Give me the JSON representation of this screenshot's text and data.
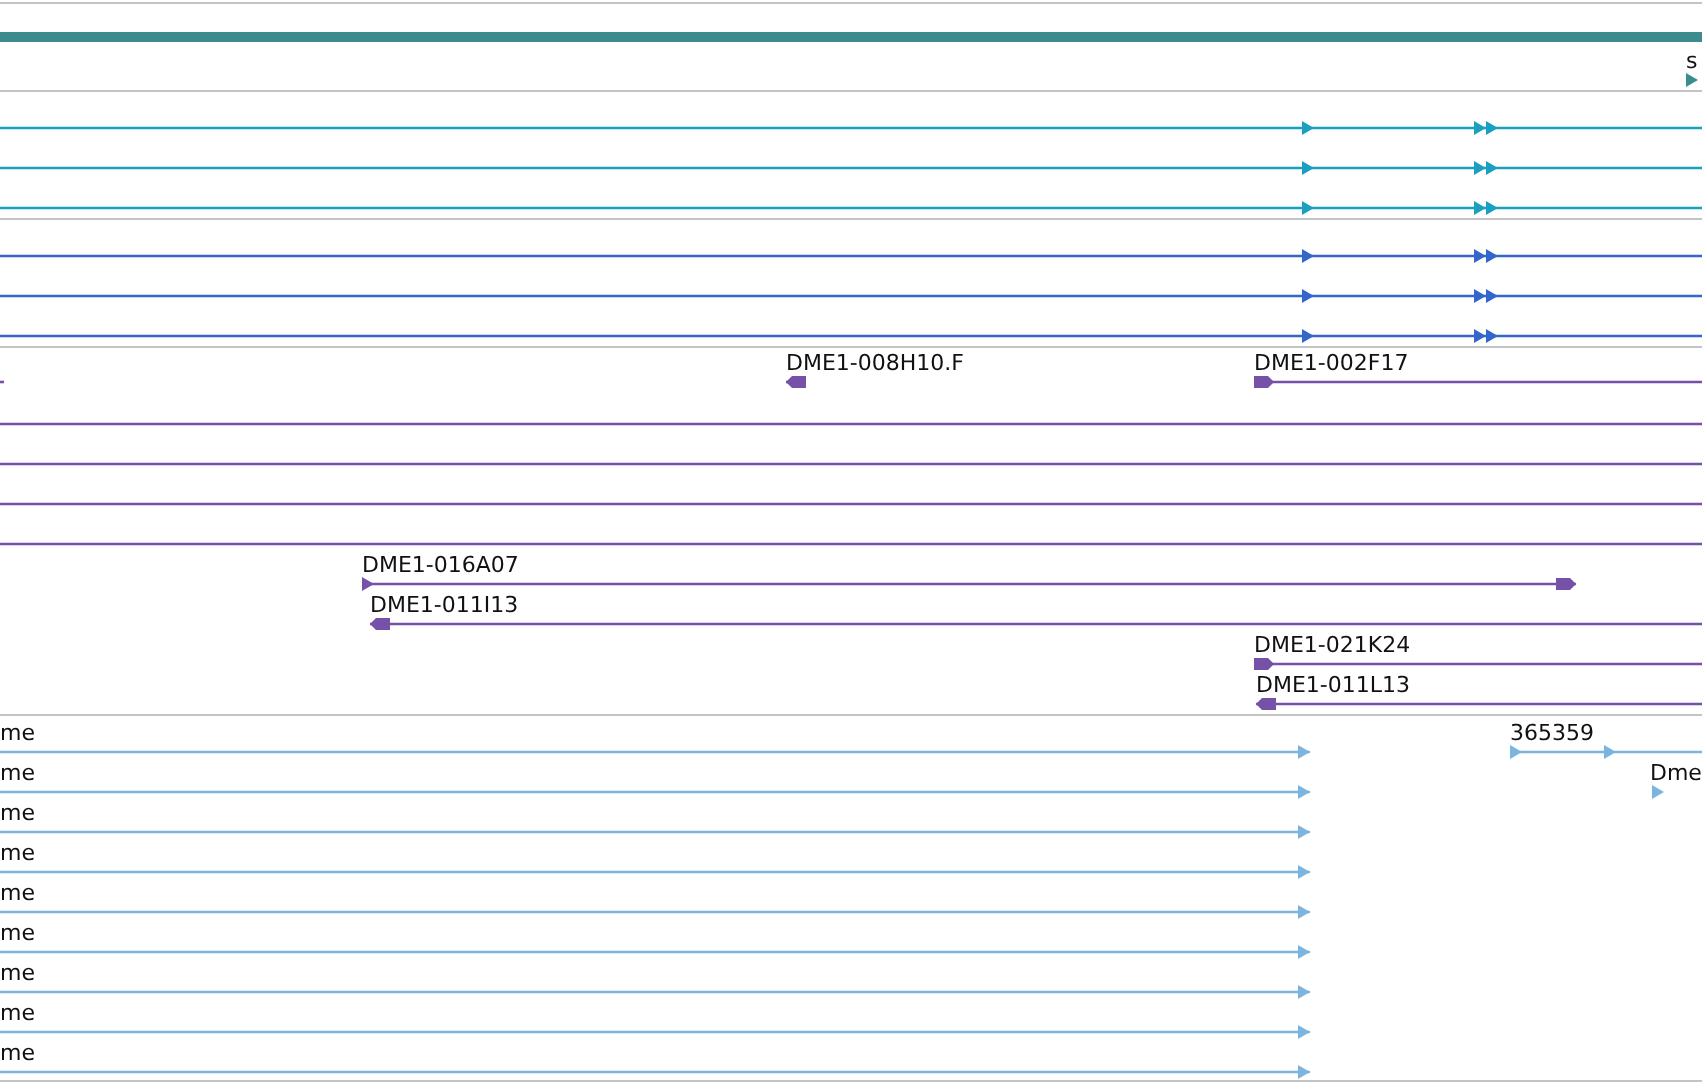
{
  "tracks": [
    {
      "color": "#3d8b8d",
      "features": [
        {
          "label": "s",
          "reverse": false
        }
      ]
    },
    {
      "color": "#1a9fc0",
      "features": [
        {
          "reverse": false
        },
        {
          "reverse": false
        },
        {
          "reverse": false
        }
      ]
    },
    {
      "color": "#3366cc",
      "features": [
        {
          "reverse": false
        },
        {
          "reverse": false
        },
        {
          "reverse": false
        }
      ]
    },
    {
      "color": "#7552a8",
      "features": [
        {
          "kind": "bare"
        },
        {
          "kind": "arrow",
          "label": "DME1-008H10.F",
          "reverse": true
        },
        {
          "kind": "arrow",
          "label": "DME1-002F17",
          "reverse": false
        },
        {
          "kind": "bare"
        },
        {
          "kind": "bare"
        },
        {
          "kind": "bare"
        },
        {
          "kind": "bare"
        },
        {
          "kind": "arrow",
          "label": "DME1-016A07",
          "reverse": false
        },
        {
          "kind": "arrow",
          "label": "DME1-011I13",
          "reverse": true
        },
        {
          "kind": "arrow",
          "label": "DME1-021K24",
          "reverse": false
        },
        {
          "kind": "arrow",
          "label": "DME1-011L13",
          "reverse": true
        }
      ]
    },
    {
      "color": "#7ab4e0",
      "features": [
        {
          "label": "me",
          "reverse": false
        },
        {
          "label": "me",
          "reverse": false
        },
        {
          "label": "me",
          "reverse": false
        },
        {
          "label": "me",
          "reverse": false
        },
        {
          "label": "me",
          "reverse": false
        },
        {
          "label": "me",
          "reverse": false
        },
        {
          "label": "me",
          "reverse": false
        },
        {
          "label": "me",
          "reverse": false
        },
        {
          "label": "me",
          "reverse": false
        },
        {
          "label": "365359",
          "reverse": false
        },
        {
          "label": "Dme",
          "reverse": false
        }
      ]
    }
  ]
}
